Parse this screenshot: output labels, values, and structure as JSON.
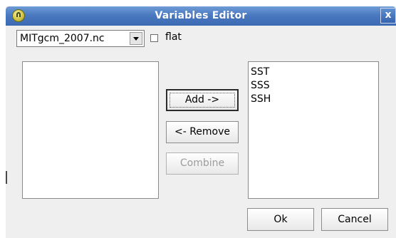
{
  "window": {
    "title": "Variables Editor",
    "close_label": "x"
  },
  "toolbar": {
    "file_select": {
      "value": "MITgcm_2007.nc"
    },
    "flat_checkbox": {
      "label": "flat",
      "checked": false
    }
  },
  "available_list": {
    "items": []
  },
  "selected_list": {
    "items": [
      {
        "label": "SST"
      },
      {
        "label": "SSS"
      },
      {
        "label": "SSH"
      }
    ]
  },
  "actions": {
    "add_label": "Add ->",
    "remove_label": "<- Remove",
    "combine_label": "Combine",
    "combine_enabled": false
  },
  "footer": {
    "ok_label": "Ok",
    "cancel_label": "Cancel"
  },
  "colors": {
    "titlebar": "#4a79c0",
    "window_bg": "#efefef",
    "disabled_text": "#9c9c9c"
  },
  "icons": {
    "app": "app-logo-icon",
    "close": "close-icon",
    "dropdown": "chevron-down-icon"
  }
}
